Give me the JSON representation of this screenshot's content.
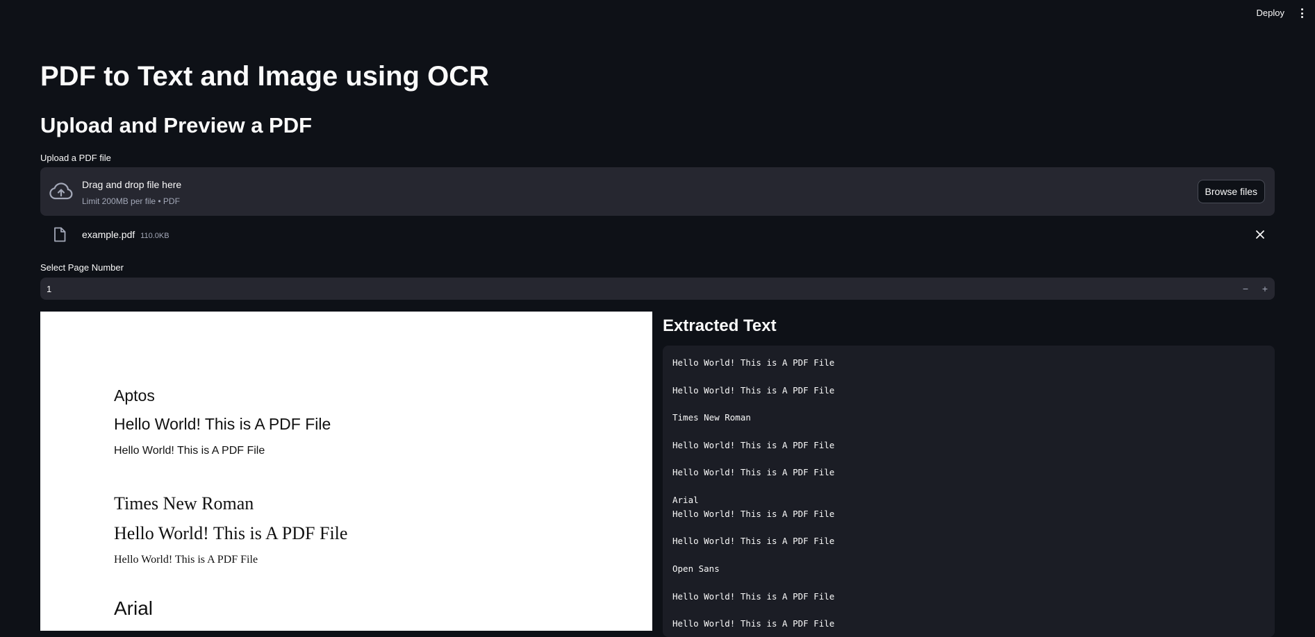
{
  "header": {
    "deploy_label": "Deploy",
    "menu_icon": "kebab-menu-icon"
  },
  "main": {
    "title": "PDF to Text and Image using OCR",
    "subtitle": "Upload and Preview a PDF"
  },
  "uploader": {
    "label": "Upload a PDF file",
    "drop_text": "Drag and drop file here",
    "limit_text": "Limit 200MB per file • PDF",
    "browse_label": "Browse files",
    "upload_icon": "cloud-upload-icon",
    "file": {
      "name": "example.pdf",
      "size": "110.0KB",
      "icon": "file-icon"
    }
  },
  "page_select": {
    "label": "Select Page Number",
    "value": "1",
    "minus": "−",
    "plus": "+"
  },
  "preview": {
    "aptos_heading": "Aptos",
    "aptos_line1": "Hello World! This is A PDF File",
    "aptos_line2": "Hello World! This is A PDF File",
    "tnr_heading": "Times New Roman",
    "tnr_line1": "Hello World! This is A PDF File",
    "tnr_line2": "Hello World! This is A PDF File",
    "arial_heading": "Arial"
  },
  "extracted": {
    "title": "Extracted Text",
    "text": "Hello World! This is A PDF File\n\nHello World! This is A PDF File\n\nTimes New Roman\n\nHello World! This is A PDF File\n\nHello World! This is A PDF File\n\nArial\nHello World! This is A PDF File\n\nHello World! This is A PDF File\n\nOpen Sans\n\nHello World! This is A PDF File\n\nHello World! This is A PDF File"
  },
  "colors": {
    "background": "#0e1117",
    "panel": "#262730",
    "code_bg": "#1b1d25",
    "text": "#fafafa",
    "muted": "#a3a8b8"
  }
}
